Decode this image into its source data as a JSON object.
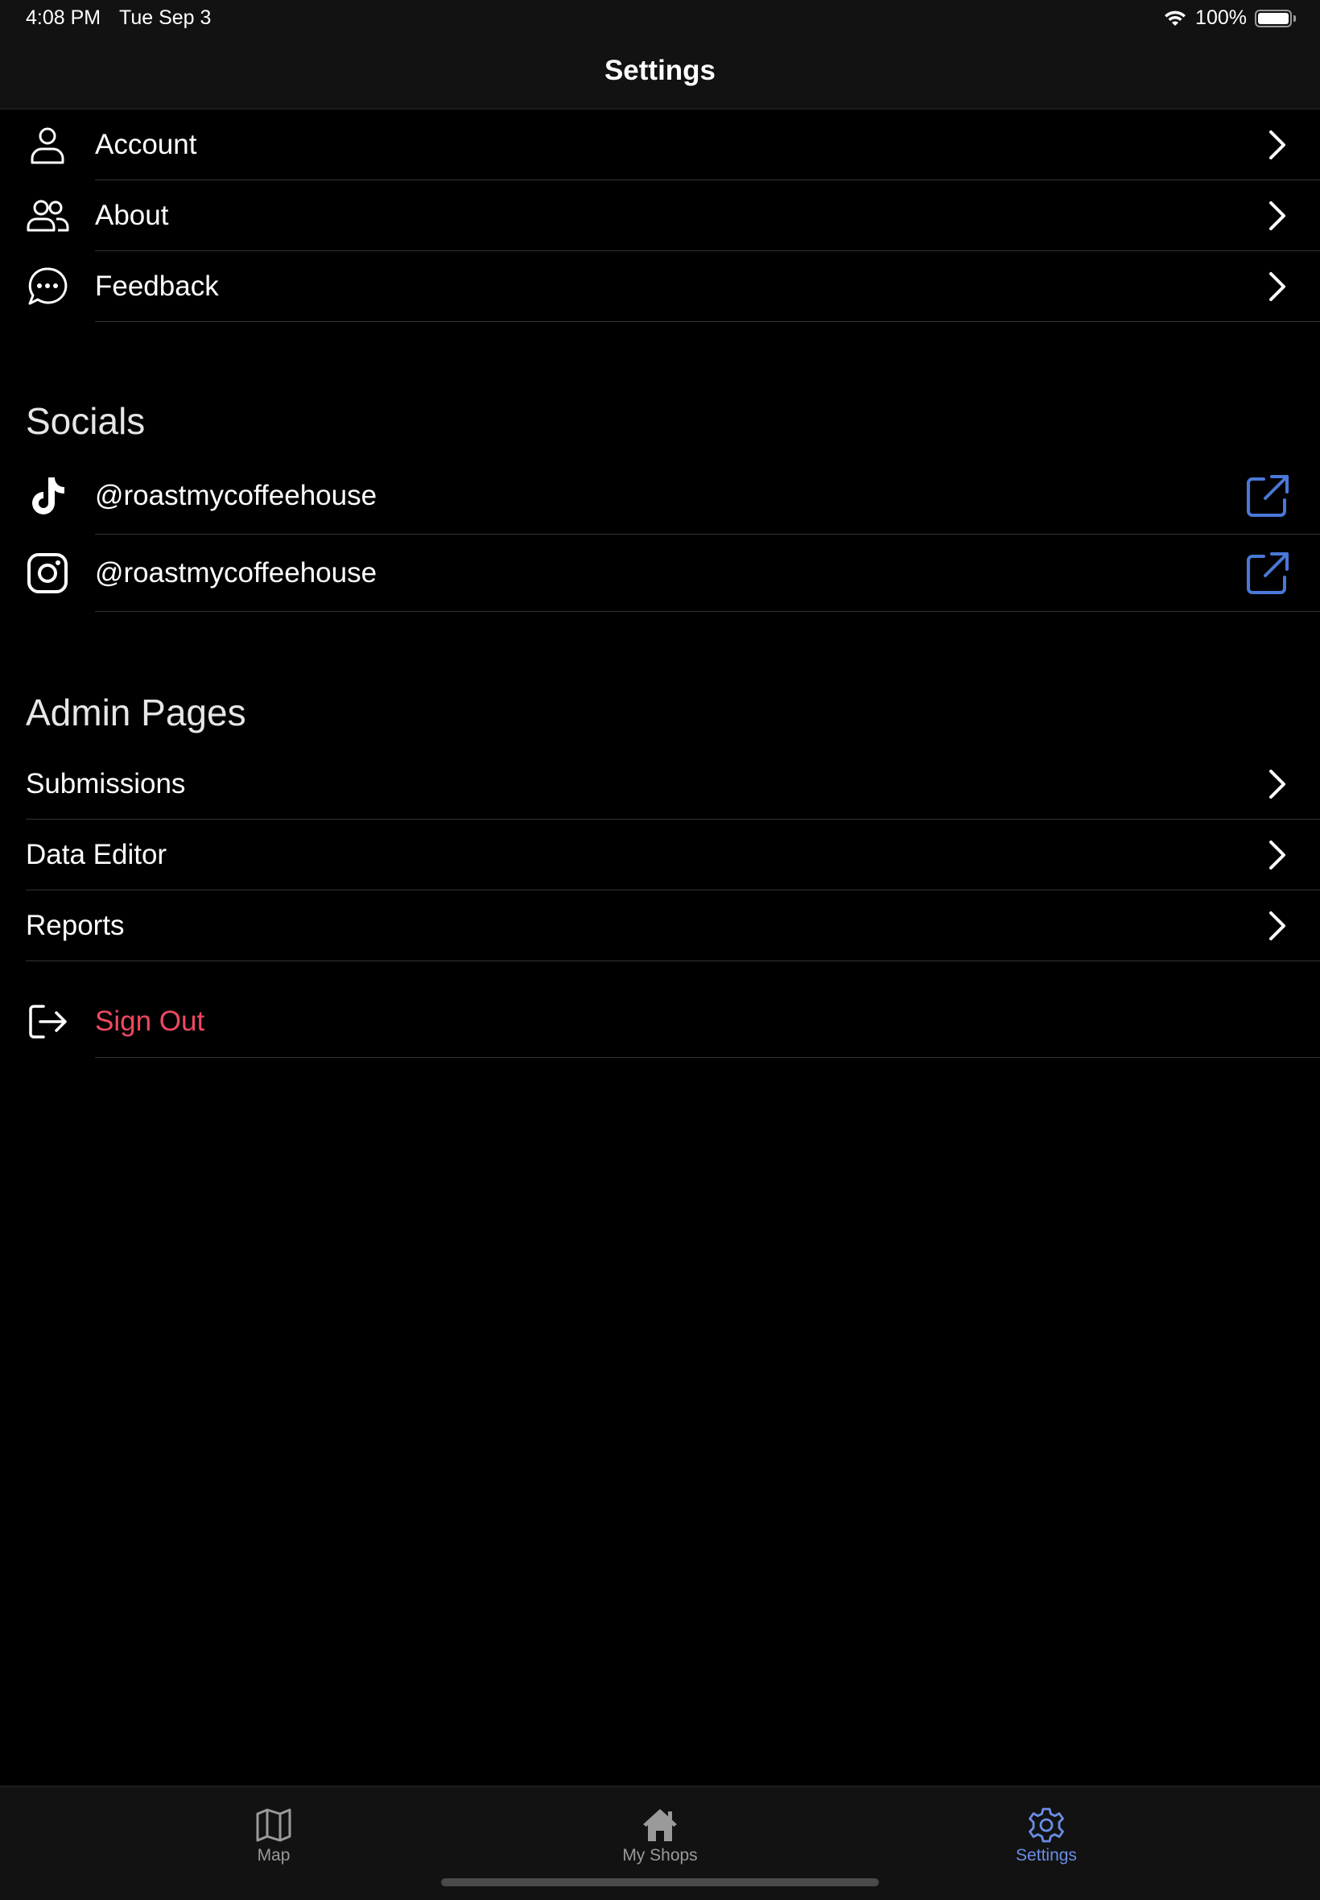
{
  "status_bar": {
    "time": "4:08 PM",
    "date": "Tue Sep 3",
    "battery_percent_label": "100%",
    "battery_level": 1.0
  },
  "nav": {
    "title": "Settings"
  },
  "general": {
    "items": [
      {
        "label": "Account",
        "icon": "person-icon"
      },
      {
        "label": "About",
        "icon": "people-icon"
      },
      {
        "label": "Feedback",
        "icon": "chat-bubble-icon"
      }
    ]
  },
  "socials": {
    "title": "Socials",
    "items": [
      {
        "label": "@roastmycoffeehouse",
        "icon": "tiktok-icon",
        "action_icon": "external-link-icon"
      },
      {
        "label": "@roastmycoffeehouse",
        "icon": "instagram-icon",
        "action_icon": "external-link-icon"
      }
    ]
  },
  "admin": {
    "title": "Admin Pages",
    "items": [
      {
        "label": "Submissions"
      },
      {
        "label": "Data Editor"
      },
      {
        "label": "Reports"
      }
    ]
  },
  "sign_out": {
    "label": "Sign Out",
    "icon": "sign-out-icon"
  },
  "tab_bar": {
    "tabs": [
      {
        "label": "Map",
        "icon": "map-icon",
        "active": false
      },
      {
        "label": "My Shops",
        "icon": "house-icon",
        "active": false
      },
      {
        "label": "Settings",
        "icon": "gear-icon",
        "active": true
      }
    ]
  },
  "colors": {
    "background": "#000000",
    "bar_background": "#121212",
    "accent": "#6a8ee6",
    "link_icon": "#4a78d8",
    "destructive": "#ee4961",
    "divider": "#333333",
    "inactive_tab": "#9a9a9a"
  }
}
